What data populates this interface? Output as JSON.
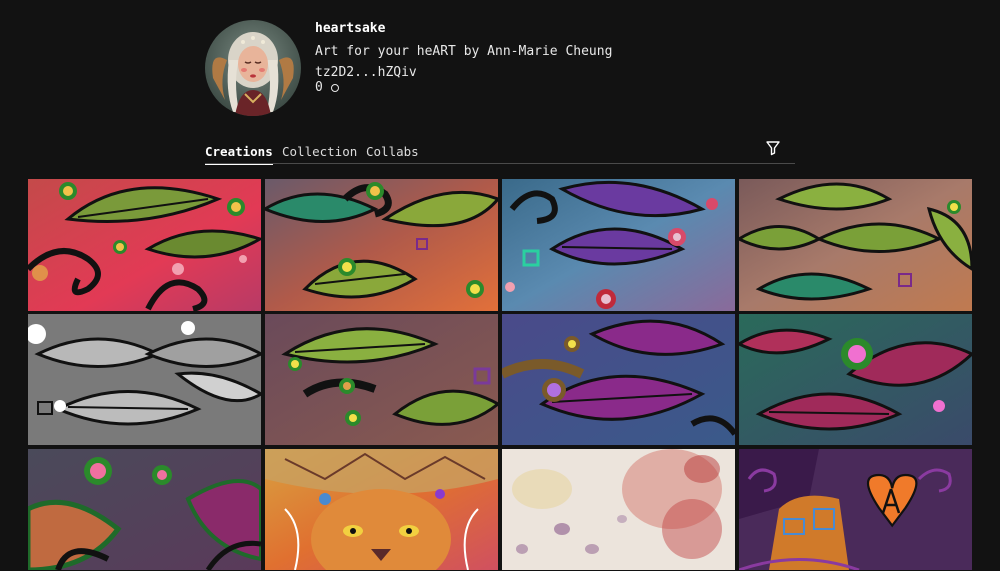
{
  "profile": {
    "username": "heartsake",
    "bio": "Art for your heART by Ann-Marie Cheung",
    "address": "tz2D2...hZQiv",
    "balance": "0"
  },
  "tabs": [
    {
      "label": "Creations",
      "active": true
    },
    {
      "label": "Collection",
      "active": false
    },
    {
      "label": "Collabs",
      "active": false
    }
  ],
  "filter": {
    "icon": "filter-icon"
  },
  "grid": {
    "items": [
      {
        "name": "leaf-art-red"
      },
      {
        "name": "leaf-art-orange"
      },
      {
        "name": "leaf-art-blue-purple"
      },
      {
        "name": "leaf-art-green"
      },
      {
        "name": "leaf-art-grayscale"
      },
      {
        "name": "leaf-art-green-dark"
      },
      {
        "name": "leaf-art-purple-blue"
      },
      {
        "name": "leaf-art-magenta"
      },
      {
        "name": "leaf-art-pink-dots"
      },
      {
        "name": "lion-art"
      },
      {
        "name": "watercolor-art"
      },
      {
        "name": "heart-monogram-art"
      }
    ]
  },
  "colors": {
    "background": "#121212",
    "text": "#ffffff",
    "divider": "#4a4a4a"
  }
}
